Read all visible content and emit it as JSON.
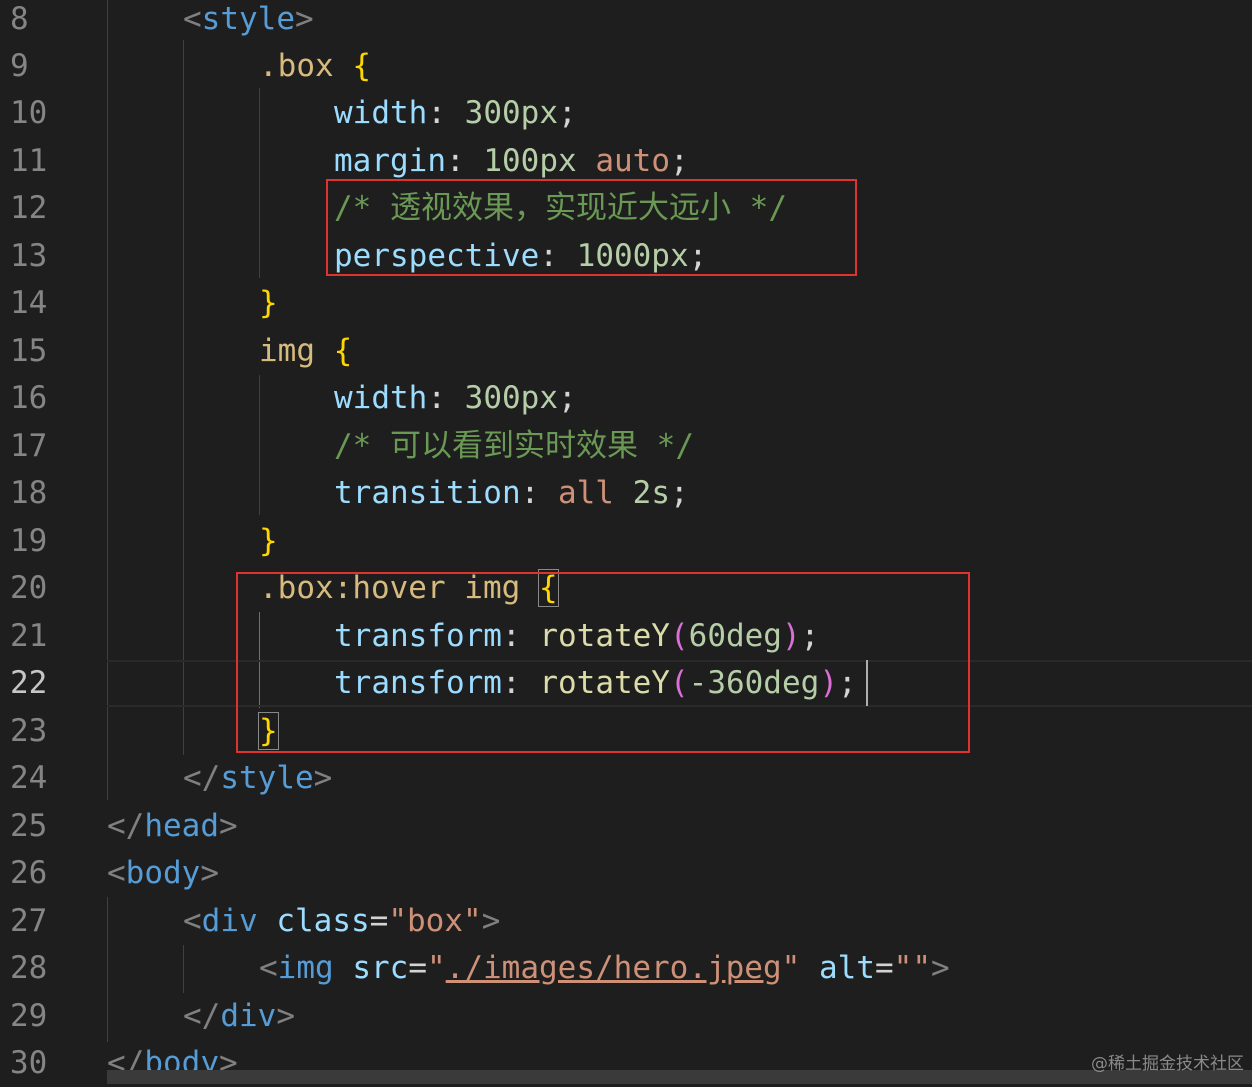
{
  "editor": {
    "lines": [
      {
        "num": "8"
      },
      {
        "num": "9"
      },
      {
        "num": "10"
      },
      {
        "num": "11"
      },
      {
        "num": "12"
      },
      {
        "num": "13"
      },
      {
        "num": "14"
      },
      {
        "num": "15"
      },
      {
        "num": "16"
      },
      {
        "num": "17"
      },
      {
        "num": "18"
      },
      {
        "num": "19"
      },
      {
        "num": "20"
      },
      {
        "num": "21"
      },
      {
        "num": "22"
      },
      {
        "num": "23"
      },
      {
        "num": "24"
      },
      {
        "num": "25"
      },
      {
        "num": "26"
      },
      {
        "num": "27"
      },
      {
        "num": "28"
      },
      {
        "num": "29"
      },
      {
        "num": "30"
      }
    ],
    "tokens": {
      "lt": "<",
      "gt": ">",
      "lt_slash": "</",
      "style": "style",
      "box_sel": ".box",
      "open_brace": "{",
      "close_brace": "}",
      "width": "width",
      "colon": ":",
      "semi": ";",
      "val_300px": "300px",
      "margin": "margin",
      "val_100px": "100px",
      "auto": "auto",
      "comment_perspective": "/* 透视效果，实现近大远小 */",
      "perspective": "perspective",
      "val_1000px": "1000px",
      "img": "img",
      "comment_realtime": "/* 可以看到实时效果 */",
      "transition": "transition",
      "all": "all",
      "val_2s": "2s",
      "hover_sel": ".box:hover img",
      "transform": "transform",
      "rotateY": "rotateY",
      "paren_open": "(",
      "paren_close": ")",
      "val_60deg": "60deg",
      "val_neg360deg": "-360deg",
      "head": "head",
      "body": "body",
      "div": "div",
      "class_attr": "class",
      "eq": "=",
      "quote": "\"",
      "box_str": "box",
      "src_attr": "src",
      "src_path": "./images/hero.jpeg",
      "alt_attr": "alt",
      "empty_str": "\"\""
    }
  },
  "watermark": "@稀土掘金技术社区"
}
